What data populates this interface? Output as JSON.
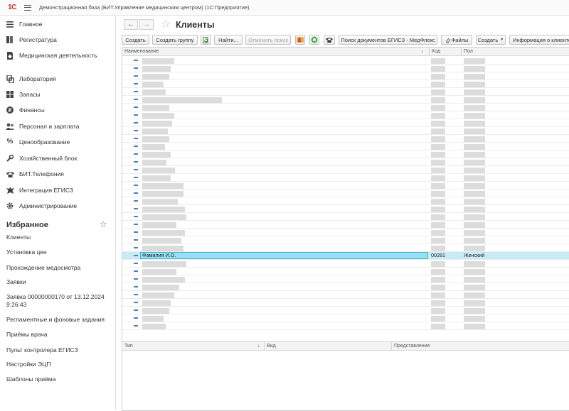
{
  "app": {
    "logo": "1С",
    "title": "Демонстрационная база (БИТ.Управление медицинским центром)  (1С:Предприятие)"
  },
  "sidebar": {
    "items": [
      {
        "label": "Главное",
        "icon": "menu-icon"
      },
      {
        "label": "Регистратура",
        "icon": "registry-icon"
      },
      {
        "label": "Медицинская деятельность",
        "icon": "medical-file-icon"
      },
      {
        "label": "Лаборатория",
        "icon": "lab-icon"
      },
      {
        "label": "Запасы",
        "icon": "stock-grid-icon"
      },
      {
        "label": "Финансы",
        "icon": "finance-coin-icon"
      },
      {
        "label": "Персонал и зарплата",
        "icon": "staff-icon"
      },
      {
        "label": "Ценообразование",
        "icon": "percent-icon"
      },
      {
        "label": "Хозяйственный блок",
        "icon": "wrench-icon"
      },
      {
        "label": "БИТ.Телефония",
        "icon": "phone-icon"
      },
      {
        "label": "Интеграция ЕГИСЗ",
        "icon": "emblem-icon"
      },
      {
        "label": "Администрирование",
        "icon": "gear-icon"
      }
    ],
    "favorites_title": "Избранное",
    "favorites": [
      "Клиенты",
      "Установка цен",
      "Прохождение медосмотра",
      "Заявки",
      "Заявка 00000000170 от 13.12.2024 9:26:43",
      "Регламентные и фоновые задания",
      "Приёмы врача",
      "Пульт контролера ЕГИСЗ",
      "Настройки ЭЦП",
      "Шаблоны приёма"
    ]
  },
  "page": {
    "title": "Клиенты",
    "back": "←",
    "forward": "→"
  },
  "toolbar": {
    "create": "Создать",
    "create_group": "Создать группу",
    "find": "Найти...",
    "cancel_search": "Отменить поиск",
    "search_docs": "Поиск документов ЕГИСЗ - МедФлекс",
    "files": "Файлы",
    "create_menu": "Создать",
    "client_info": "Информация о клиенте"
  },
  "grid": {
    "columns": [
      "Наименование",
      "Код",
      "Пол"
    ],
    "selected_row": {
      "name": "Фамилия И.О.",
      "code": "00281",
      "gender": "Женский"
    },
    "sort_indicator": "↓"
  },
  "subgrid": {
    "columns": [
      "Тип",
      "Вид",
      "Представление"
    ],
    "sort_indicator": "↓"
  },
  "colors": {
    "logo_red": "#d6271c",
    "selected_row": "#c9ebf5",
    "selected_cell": "#9be0f0",
    "row_marker": "#4b7fb7"
  }
}
